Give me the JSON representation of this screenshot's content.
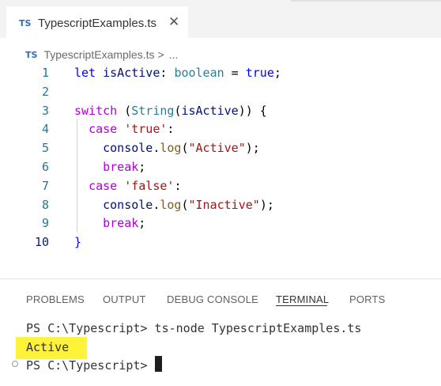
{
  "editor_tab": {
    "lang_badge": "TS",
    "title": "TypescriptExamples.ts",
    "close_glyph": "✕"
  },
  "breadcrumb": {
    "lang_badge": "TS",
    "file": "TypescriptExamples.ts",
    "separator": ">",
    "more": "..."
  },
  "code_lines": [
    {
      "n": "1",
      "tokens": [
        [
          "k-blue",
          "let "
        ],
        [
          "k-var",
          "isActive"
        ],
        [
          "k-plain",
          ": "
        ],
        [
          "k-type",
          "boolean"
        ],
        [
          "k-plain",
          " = "
        ],
        [
          "k-blue",
          "true"
        ],
        [
          "k-plain",
          ";"
        ]
      ]
    },
    {
      "n": "2",
      "tokens": []
    },
    {
      "n": "3",
      "tokens": [
        [
          "k-ctrl",
          "switch"
        ],
        [
          "k-plain",
          " ("
        ],
        [
          "k-type",
          "String"
        ],
        [
          "k-plain",
          "("
        ],
        [
          "k-var",
          "isActive"
        ],
        [
          "k-plain",
          ")) {"
        ]
      ]
    },
    {
      "n": "4",
      "tokens": [
        [
          "k-plain",
          "  "
        ],
        [
          "k-ctrl",
          "case"
        ],
        [
          "k-plain",
          " "
        ],
        [
          "k-str",
          "'true'"
        ],
        [
          "k-plain",
          ":"
        ]
      ]
    },
    {
      "n": "5",
      "tokens": [
        [
          "k-plain",
          "    "
        ],
        [
          "k-var",
          "console"
        ],
        [
          "k-plain",
          "."
        ],
        [
          "k-fn",
          "log"
        ],
        [
          "k-plain",
          "("
        ],
        [
          "k-str",
          "\"Active\""
        ],
        [
          "k-plain",
          ");"
        ]
      ]
    },
    {
      "n": "6",
      "tokens": [
        [
          "k-plain",
          "    "
        ],
        [
          "k-ctrl",
          "break"
        ],
        [
          "k-plain",
          ";"
        ]
      ]
    },
    {
      "n": "7",
      "tokens": [
        [
          "k-plain",
          "  "
        ],
        [
          "k-ctrl",
          "case"
        ],
        [
          "k-plain",
          " "
        ],
        [
          "k-str",
          "'false'"
        ],
        [
          "k-plain",
          ":"
        ]
      ]
    },
    {
      "n": "8",
      "tokens": [
        [
          "k-plain",
          "    "
        ],
        [
          "k-var",
          "console"
        ],
        [
          "k-plain",
          "."
        ],
        [
          "k-fn",
          "log"
        ],
        [
          "k-plain",
          "("
        ],
        [
          "k-str",
          "\"Inactive\""
        ],
        [
          "k-plain",
          ");"
        ]
      ]
    },
    {
      "n": "9",
      "tokens": [
        [
          "k-plain",
          "    "
        ],
        [
          "k-ctrl",
          "break"
        ],
        [
          "k-plain",
          ";"
        ]
      ]
    },
    {
      "n": "10",
      "tokens": [
        [
          "k-blue",
          "}"
        ]
      ]
    }
  ],
  "active_line": "10",
  "panel_tabs": [
    "PROBLEMS",
    "OUTPUT",
    "DEBUG CONSOLE",
    "TERMINAL",
    "PORTS"
  ],
  "active_panel_tab": "TERMINAL",
  "terminal": {
    "command_line": "PS C:\\Typescript> ts-node TypescriptExamples.ts",
    "output": "Active",
    "prompt": "PS C:\\Typescript> "
  },
  "colors": {
    "ts_badge": "#2c6ebf",
    "highlight": "#fff23a",
    "line_number": "#237893"
  }
}
